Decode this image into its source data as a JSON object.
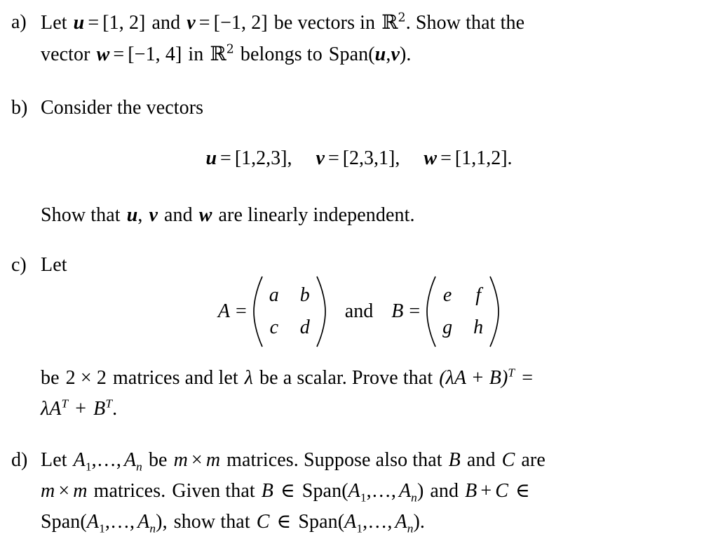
{
  "document": {
    "type": "math-exercise-sheet",
    "background_color": "#ffffff",
    "text_color": "#000000"
  },
  "items": [
    {
      "label": "a)",
      "id": "item-a",
      "lines": [
        "Let u = [1, 2] and v = [-1, 2] be vectors in R^2. Show that the",
        "vector w = [-1, 4] in R^2 belongs to Span(u, v)."
      ],
      "math": {
        "let_word": "Let",
        "u_symbol": "u",
        "v_symbol": "v",
        "w_symbol": "w",
        "equals": "=",
        "u_value": "[1, 2]",
        "v_value": "[−1, 2]",
        "w_value": "[−1, 4]",
        "and_word": "and",
        "be_vectors_in": "be vectors in",
        "field": "R",
        "field_exponent": "2",
        "show_that_the": ". Show that the",
        "vector_word": "vector",
        "in_word": "in",
        "belongs_to": "belongs to",
        "span_word": "Span",
        "span_args": "(u,v)",
        "period": "."
      }
    },
    {
      "label": "b)",
      "id": "item-b",
      "lines": [
        "Consider the vectors",
        "u = [1, 2, 3],   v = [2, 3, 1],   w = [1, 1, 2].",
        "Show that u, v and w are linearly independent."
      ],
      "intro": "Consider the vectors",
      "equation": {
        "u_symbol": "u",
        "u_value": "[1,2,3],",
        "v_symbol": "v",
        "v_value": "[2,3,1],",
        "w_symbol": "w",
        "w_value": "[1,1,2].",
        "equals": "="
      },
      "conclusion": {
        "show_that": "Show that",
        "u_symbol": "u",
        "comma": ",",
        "v_symbol": "v",
        "and_word": "and",
        "w_symbol": "w",
        "tail": "are linearly independent."
      }
    },
    {
      "label": "c)",
      "id": "item-c",
      "intro": "Let",
      "matrices": [
        {
          "name": "A",
          "equals": "=",
          "cells": [
            "a",
            "b",
            "c",
            "d"
          ]
        },
        {
          "name": "B",
          "equals": "=",
          "cells": [
            "e",
            "f",
            "g",
            "h"
          ]
        }
      ],
      "conjunction": "and",
      "body": {
        "be_word": "be",
        "dimension": "2 × 2",
        "matrices_word": "matrices and let",
        "lambda": "λ",
        "scalar_phrase": "be a scalar.  Prove that",
        "claim_lhs": "(λA + B)",
        "transpose": "T",
        "equals": "=",
        "claim_rhs_lambda": "λ",
        "claim_rhs_a": "A",
        "claim_rhs_plus": "+",
        "claim_rhs_b": "B",
        "period": "."
      }
    },
    {
      "label": "d)",
      "id": "item-d",
      "lines": [
        "Let A_1, ..., A_n be m x m matrices. Suppose also that B and C are",
        "m x m matrices.  Given that B in Span(A_1, ..., A_n) and B + C in",
        "Span(A_1, ..., A_n), show that C in Span(A_1, ..., A_n)."
      ],
      "math": {
        "let_word": "Let",
        "A": "A",
        "sub_one": "1",
        "sub_n": "n",
        "ellipsis": ",…,",
        "be_word": "be",
        "m": "m",
        "times": "×",
        "matrices_are": "matrices.  Suppose also that",
        "B": "B",
        "C": "C",
        "and_word": "and",
        "are_word": "are",
        "matrices_word": "matrices.",
        "given_that": "Given that",
        "in_symbol": "∈",
        "span_word": "Span",
        "plus": "+",
        "show_that": "show that",
        "period": ".",
        "comma": ","
      }
    }
  ]
}
